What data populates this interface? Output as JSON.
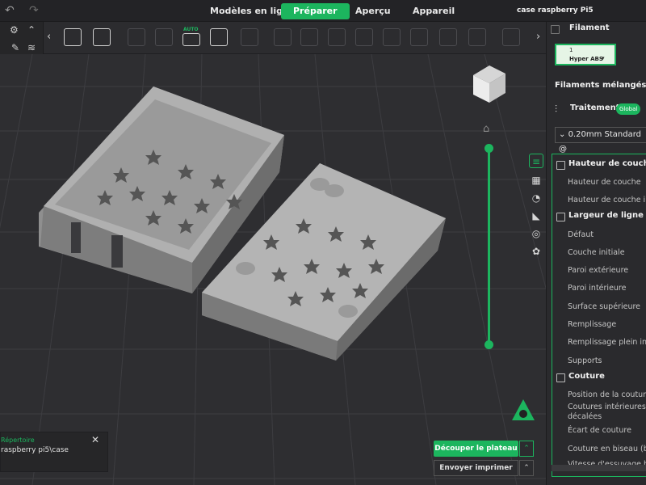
{
  "topbar": {
    "tabs": [
      {
        "label": "Modèles en ligne",
        "active": false
      },
      {
        "label": "Préparer",
        "active": true
      },
      {
        "label": "Aperçu",
        "active": false
      },
      {
        "label": "Appareil",
        "active": false
      }
    ],
    "project_name": "case raspberry Pi5"
  },
  "toolbar": {
    "auto_label": "AUTO",
    "icons": [
      "add-object-icon",
      "grid-plate-icon",
      "orient-icon",
      "rotate-icon",
      "auto-orient-icon",
      "arrange-icon",
      "split-icon",
      "cut-icon",
      "layers-icon",
      "text-icon",
      "boolean-icon",
      "emboss-icon",
      "assembly-icon",
      "measure-icon",
      "support-paint-icon",
      "seam-icon"
    ]
  },
  "notification": {
    "title": "Répertoire",
    "path": "raspberry pi5\\case",
    "close": "✕"
  },
  "actions": {
    "slice_label": "Découper le plateau",
    "print_label": "Envoyer imprimer"
  },
  "sidebar": {
    "filament_header": "Filament",
    "filament_slot": "1",
    "filament_name": "Hyper ABS",
    "mixed_header": "Filaments mélangés",
    "process_header": "Traitement",
    "process_toggle": "Global",
    "preset": "0.20mm Standard @",
    "sections": [
      {
        "title": "Hauteur de couche",
        "items": [
          "Hauteur de couche",
          "Hauteur de couche in"
        ]
      },
      {
        "title": "Largeur de ligne",
        "items": [
          "Défaut",
          "Couche initiale",
          "Paroi extérieure",
          "Paroi intérieure",
          "Surface supérieure",
          "Remplissage",
          "Remplissage plein in",
          "Supports"
        ]
      },
      {
        "title": "Couture",
        "items": [
          "Position de la couture",
          "Coutures intérieures",
          "décalées",
          "Écart de couture",
          "Couture en biseau (b",
          "Vitesse d'essuyage b"
        ]
      }
    ]
  },
  "colors": {
    "accent": "#1cb55e",
    "bed": "#2e2e31",
    "model": "#9e9e9e"
  }
}
